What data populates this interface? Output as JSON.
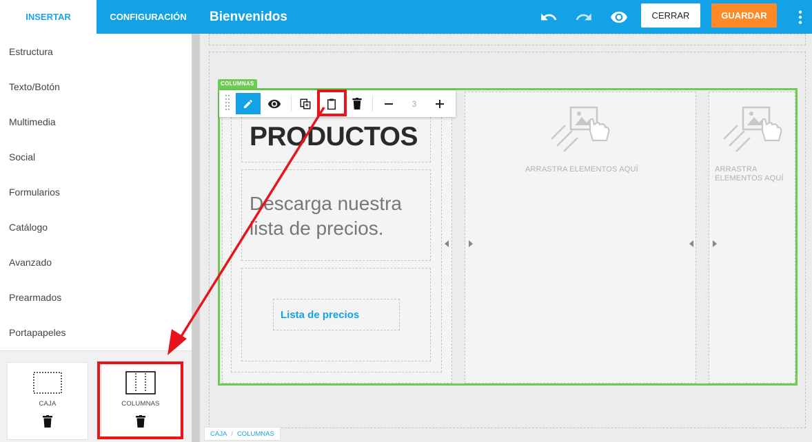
{
  "sidebar": {
    "tabs": {
      "insert": "INSERTAR",
      "config": "CONFIGURACIÓN"
    },
    "menu": [
      "Estructura",
      "Texto/Botón",
      "Multimedia",
      "Social",
      "Formularios",
      "Catálogo",
      "Avanzado",
      "Prearmados",
      "Portapapeles"
    ],
    "cards": {
      "caja": "CAJA",
      "columnas": "COLUMNAS"
    }
  },
  "topbar": {
    "title": "Bienvenidos",
    "close_label": "CERRAR",
    "save_label": "GUARDAR"
  },
  "canvas": {
    "columns_tag": "COLUMNAS",
    "toolbar": {
      "column_count": "3"
    },
    "heading": "PRODUCTOS",
    "body": "Descarga nuestra lista de precios.",
    "link": "Lista de precios",
    "drop_hint": "ARRASTRA ELEMENTOS AQUÍ",
    "drop_hint_line1": "ARRASTRA",
    "drop_hint_line2": "ELEMENTOS AQUÍ"
  },
  "breadcrumb": [
    "CAJA",
    "COLUMNAS"
  ],
  "colors": {
    "primary": "#14a2e6",
    "accent": "#ff8a27",
    "selection": "#6ccb52",
    "annotation": "#e8141c"
  },
  "icons": [
    "undo-icon",
    "redo-icon",
    "eye-icon",
    "more-vert-icon",
    "pencil-icon",
    "copy-icon",
    "paste-icon",
    "trash-icon",
    "minus-icon",
    "plus-icon",
    "drag-handle-icon",
    "image-drop-icon"
  ]
}
